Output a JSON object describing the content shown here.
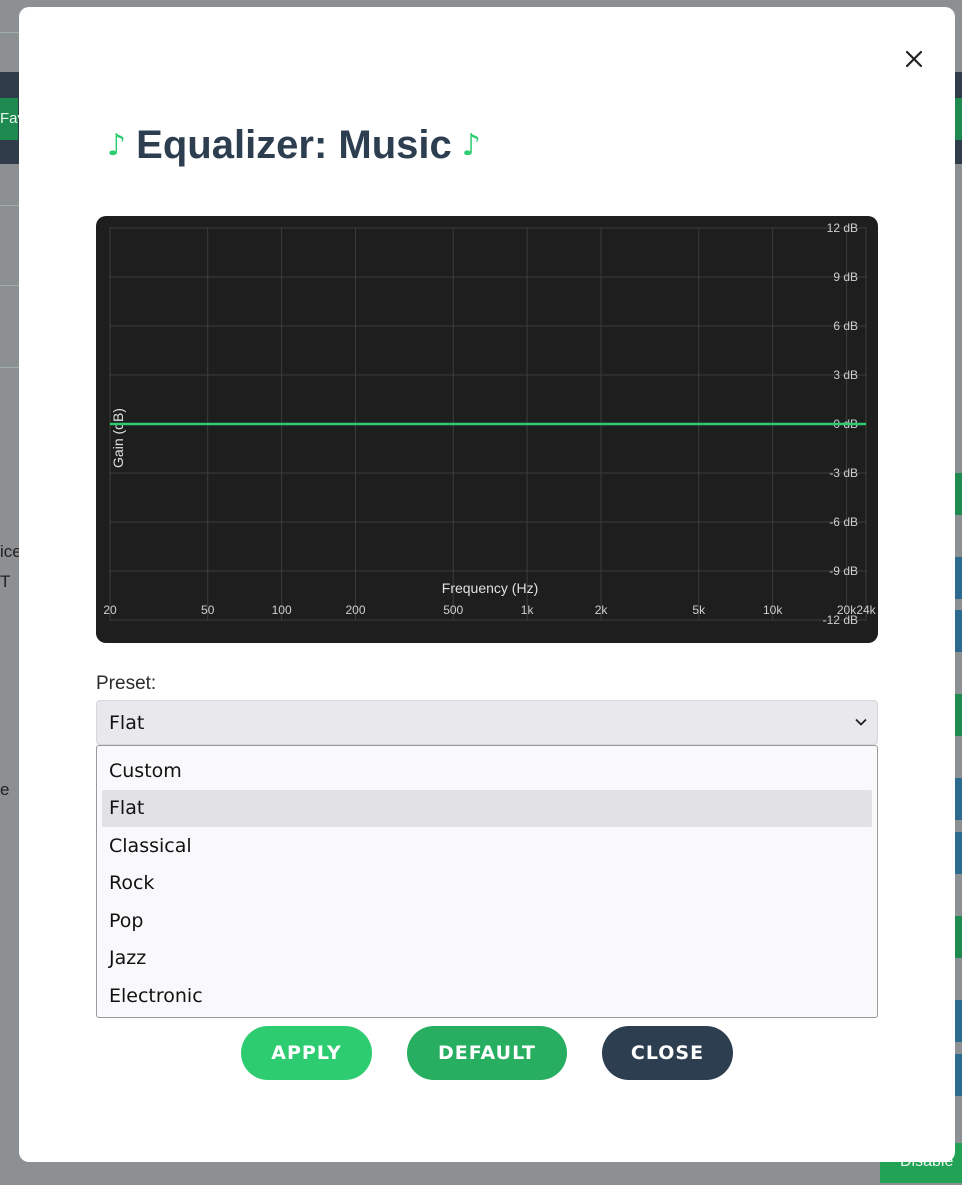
{
  "background": {
    "fragments": [
      "Fav",
      "ice",
      "T",
      "e"
    ],
    "disable_label": "Disable"
  },
  "modal": {
    "title": "Equalizer: Music",
    "title_icon": "music-note-icon",
    "title_icon_glyph": "♪",
    "close_icon": "close-icon"
  },
  "chart_data": {
    "type": "line",
    "xlabel": "Frequency (Hz)",
    "ylabel": "Gain (dB)",
    "xscale": "log",
    "x_ticks": [
      "20",
      "50",
      "100",
      "200",
      "500",
      "1k",
      "2k",
      "5k",
      "10k",
      "20k",
      "24k"
    ],
    "y_ticks": [
      "12 dB",
      "9 dB",
      "6 dB",
      "3 dB",
      "0 dB",
      "-3 dB",
      "-6 dB",
      "-9 dB",
      "-12 dB"
    ],
    "ylim": [
      -12,
      12
    ],
    "grid": true,
    "series": [
      {
        "color": "#2ecc71",
        "x": [
          20,
          24000
        ],
        "y": [
          0,
          0
        ]
      }
    ]
  },
  "preset": {
    "label": "Preset:",
    "selected": "Flat",
    "options": [
      "Custom",
      "Flat",
      "Classical",
      "Rock",
      "Pop",
      "Jazz",
      "Electronic"
    ]
  },
  "buttons": {
    "apply": "APPLY",
    "default": "DEFAULT",
    "close": "CLOSE"
  },
  "colors": {
    "accent": "#2ecc71",
    "accent_dark": "#27ae60",
    "navy": "#2c3e50"
  }
}
